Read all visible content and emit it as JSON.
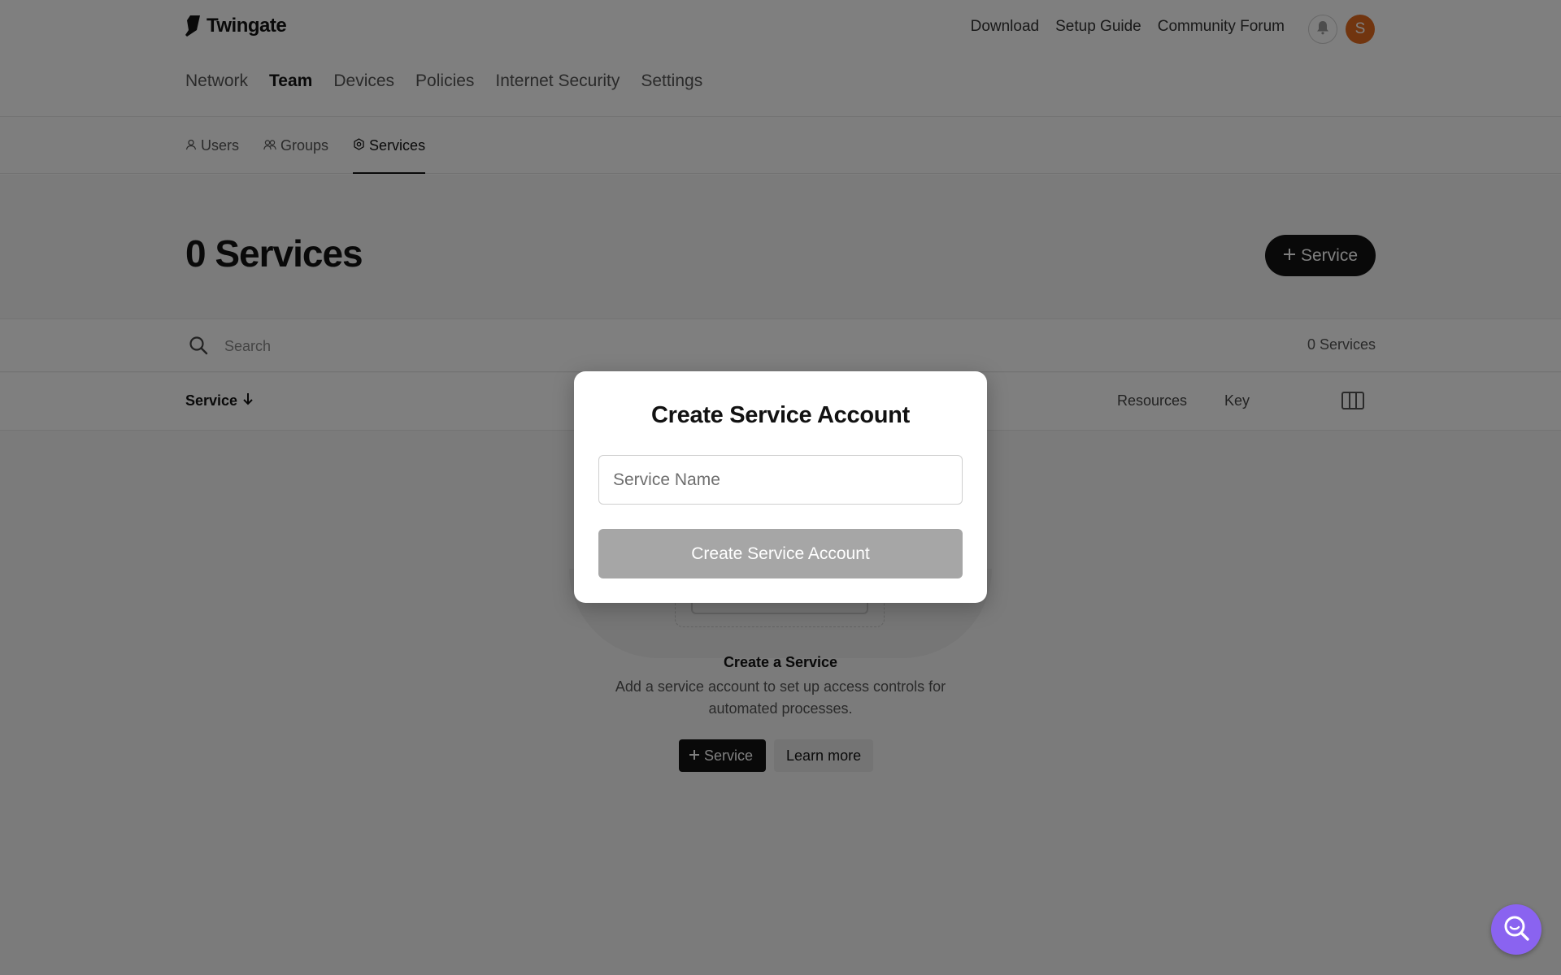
{
  "header": {
    "brand": "Twingate",
    "links": [
      "Download",
      "Setup Guide",
      "Community Forum"
    ],
    "avatar_initial": "S",
    "icons": {
      "logo": "twingate-logo-icon",
      "bell": "bell-icon"
    }
  },
  "main_nav": {
    "items": [
      {
        "label": "Network"
      },
      {
        "label": "Team",
        "active": true
      },
      {
        "label": "Devices"
      },
      {
        "label": "Policies"
      },
      {
        "label": "Internet Security"
      },
      {
        "label": "Settings"
      }
    ]
  },
  "sub_nav": {
    "items": [
      {
        "label": "Users",
        "icon": "user-icon"
      },
      {
        "label": "Groups",
        "icon": "group-icon"
      },
      {
        "label": "Services",
        "icon": "gear-icon",
        "active": true
      }
    ]
  },
  "page": {
    "title": "0 Services",
    "add_button_label": "Service"
  },
  "search": {
    "placeholder": "Search",
    "count_label": "0 Services"
  },
  "table": {
    "columns": {
      "service": "Service",
      "resources": "Resources",
      "key": "Key"
    },
    "sort_icon": "arrow-down-icon"
  },
  "empty_state": {
    "title": "Create a Service",
    "description": "Add a service account to set up access controls for automated processes.",
    "primary_label": "Service",
    "secondary_label": "Learn more"
  },
  "modal": {
    "title": "Create Service Account",
    "input_placeholder": "Service Name",
    "input_value": "",
    "submit_label": "Create Service Account"
  },
  "colors": {
    "primary": "#121212",
    "avatar": "#e26a1e",
    "help_fab": "#8a63f0",
    "disabled_button": "#a6a6a6"
  }
}
